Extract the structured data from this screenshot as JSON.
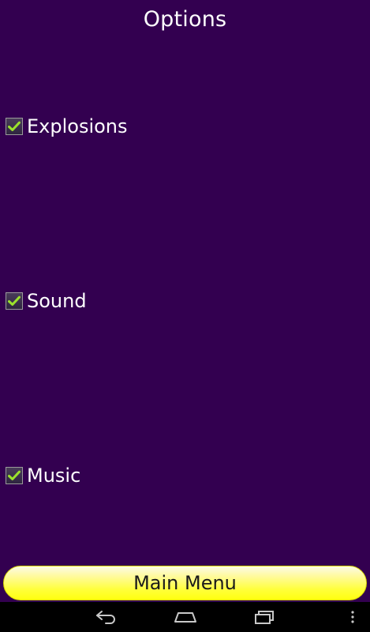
{
  "title": "Options",
  "options": [
    {
      "label": "Explosions",
      "checked": true
    },
    {
      "label": "Sound",
      "checked": true
    },
    {
      "label": "Music",
      "checked": true
    }
  ],
  "main_menu_label": "Main Menu",
  "colors": {
    "background": "#330050",
    "checkmark": "#9be22c",
    "button_yellow": "#ffff10"
  },
  "navbar": {
    "icons": [
      "back-icon",
      "home-icon",
      "recents-icon",
      "menu-icon"
    ]
  }
}
